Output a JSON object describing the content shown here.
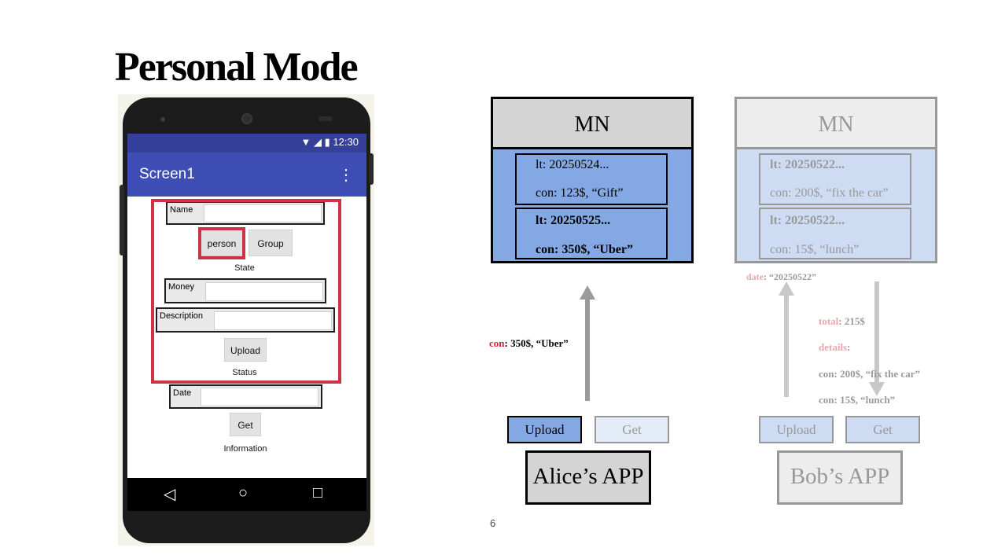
{
  "slide": {
    "title": "Personal Mode",
    "page_number": "6"
  },
  "phone": {
    "status_time": "12:30",
    "app_title": "Screen1",
    "menu_icon": "more-vert-icon",
    "form": {
      "name_label": "Name",
      "person_button": "person",
      "group_button": "Group",
      "state_label": "State",
      "money_label": "Money",
      "description_label": "Description",
      "upload_button": "Upload",
      "status_label": "Status",
      "date_label": "Date",
      "get_button": "Get",
      "information_label": "Information"
    },
    "highlight_color": "#cc3344",
    "appbar_color": "#3f4eb5"
  },
  "alice": {
    "mn_title": "MN",
    "ledger": [
      {
        "lt": "lt: 20250524...",
        "con": "con: 123$, “Gift”"
      },
      {
        "lt": "lt: 20250525...",
        "con": "con: 350$, “Uber”"
      }
    ],
    "request_key": "con",
    "request_value": ": 350$, “Uber”",
    "upload_button": "Upload",
    "get_button": "Get",
    "app_name": "Alice’s APP"
  },
  "bob": {
    "mn_title": "MN",
    "ledger": [
      {
        "lt": "lt: 20250522...",
        "con": "con: 200$, “fix the car”"
      },
      {
        "lt": "lt: 20250522...",
        "con": "con: 15$, “lunch”"
      }
    ],
    "date_key": "date",
    "date_value": ": “20250522”",
    "total_key": "total",
    "total_value": ": 215$",
    "details_key": "details",
    "details_value": ":",
    "detail_lines": [
      "con: 200$, “fix the car”",
      "con: 15$, “lunch”"
    ],
    "upload_button": "Upload",
    "get_button": "Get",
    "app_name": "Bob’s APP"
  },
  "colors": {
    "ledger_blue": "#83a8e3",
    "header_gray": "#d4d4d4",
    "key_red": "#cc2233"
  }
}
